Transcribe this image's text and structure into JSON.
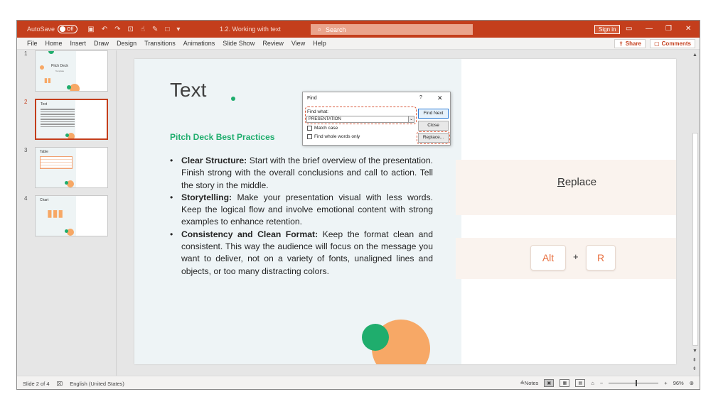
{
  "app": {
    "autosave_label": "AutoSave",
    "autosave_state": "Off",
    "doc_title": "1.2. Working with text",
    "search_placeholder": "Search",
    "sign_in": "Sign in",
    "accent": "#c43e1c"
  },
  "menu": {
    "items": [
      "File",
      "Home",
      "Insert",
      "Draw",
      "Design",
      "Transitions",
      "Animations",
      "Slide Show",
      "Review",
      "View",
      "Help"
    ],
    "share": "Share",
    "comments": "Comments"
  },
  "thumbnails": [
    {
      "number": "1",
      "title": "Pitch Deck",
      "subtitle": "Template"
    },
    {
      "number": "2",
      "title": "Text"
    },
    {
      "number": "3",
      "title": "Table"
    },
    {
      "number": "4",
      "title": "Chart"
    }
  ],
  "slide": {
    "title": "Text",
    "subtitle": "Pitch Deck Best Practices",
    "bullets": [
      {
        "head": "Clear Structure:",
        "body": " Start with the brief overview of the presentation. Finish strong with the overall conclusions and call to action. Tell the story in the middle."
      },
      {
        "head": "Storytelling:",
        "body": " Make your presentation visual with less words. Keep the logical flow and involve emotional content with strong examples to enhance retention."
      },
      {
        "head": "Consistency and Clean Format:",
        "body": " Keep the format clean and consistent. This way the audience will focus on the message you want to deliver, not on a variety of fonts, unaligned lines and objects, or too many distracting colors."
      }
    ],
    "green": "#1fad6d",
    "orange": "#f7a866"
  },
  "find_dialog": {
    "title": "Find",
    "help": "?",
    "close_x": "✕",
    "find_what_label": "Find what:",
    "find_what_value": "PRESENTATION",
    "match_case": "Match case",
    "whole_words": "Find whole words only",
    "find_next": "Find Next",
    "close": "Close",
    "replace": "Replace..."
  },
  "hint_panel": {
    "replace_label": "Replace",
    "key1": "Alt",
    "plus": "+",
    "key2": "R"
  },
  "status": {
    "slide_info": "Slide 2 of 4",
    "language": "English (United States)",
    "notes": "Notes",
    "zoom": "96%"
  }
}
